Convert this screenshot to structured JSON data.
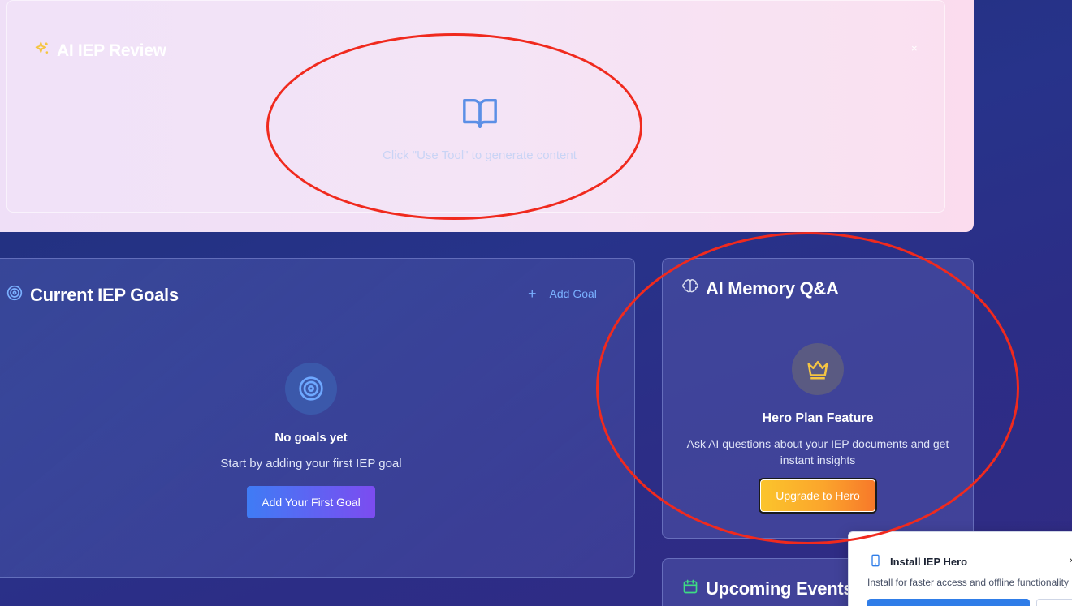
{
  "review": {
    "title": "AI IEP Review",
    "close": "×",
    "hint": "Click \"Use Tool\" to generate content"
  },
  "goals": {
    "title": "Current IEP Goals",
    "add_label": "Add Goal",
    "plus": "+",
    "empty_title": "No goals yet",
    "empty_sub": "Start by adding your first IEP goal",
    "first_goal_button": "Add Your First Goal"
  },
  "memory": {
    "title": "AI Memory Q&A",
    "feature_title": "Hero Plan Feature",
    "feature_desc": "Ask AI questions about your IEP documents and get instant insights",
    "upgrade_button": "Upgrade to Hero"
  },
  "events": {
    "title": "Upcoming Events"
  },
  "install": {
    "title": "Install IEP Hero",
    "desc": "Install for faster access and offline functionality",
    "close": "×"
  },
  "colors": {
    "accent_link": "#7ab0ff",
    "annotation_red": "#f02a1e",
    "icon_sparkle": "#f5c542",
    "icon_events": "#3ddc84"
  }
}
